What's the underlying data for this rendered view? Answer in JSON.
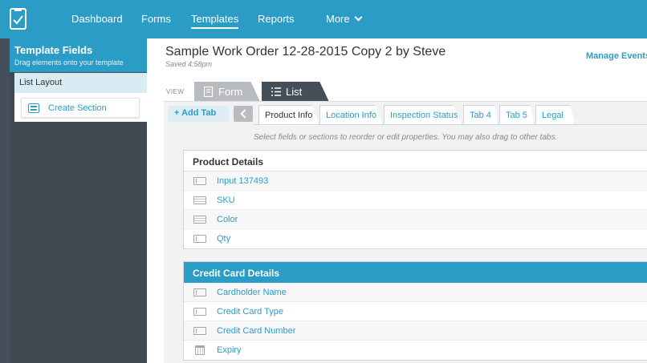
{
  "nav": {
    "items": [
      {
        "label": "Dashboard",
        "active": false
      },
      {
        "label": "Forms",
        "active": false
      },
      {
        "label": "Templates",
        "active": true
      },
      {
        "label": "Reports",
        "active": false
      }
    ],
    "more_label": "More",
    "accent_color": "#2b9cc6"
  },
  "sidebar": {
    "title": "Template Fields",
    "subtitle": "Drag elements onto your template",
    "layout_label": "List Layout",
    "create_section_label": "Create Section"
  },
  "header": {
    "title": "Sample Work Order 12-28-2015 Copy 2 by Steve",
    "saved": "Saved 4:58pm",
    "manage_events": "Manage Events"
  },
  "view": {
    "label": "VIEW",
    "form_label": "Form",
    "list_label": "List",
    "selected": "List"
  },
  "tabs": {
    "add_label": "Add Tab",
    "items": [
      {
        "label": "Product Info",
        "active": true
      },
      {
        "label": "Location Info",
        "active": false
      },
      {
        "label": "Inspection Status",
        "active": false
      },
      {
        "label": "Tab 4",
        "active": false
      },
      {
        "label": "Tab 5",
        "active": false
      },
      {
        "label": "Legal",
        "active": false
      }
    ]
  },
  "hint": "Select fields or sections to reorder or edit properties. You may also drag to other tabs.",
  "sections": [
    {
      "title": "Product Details",
      "selected": false,
      "fields": [
        {
          "label": "Input 137493",
          "icon": "text-field-icon"
        },
        {
          "label": "SKU",
          "icon": "table-field-icon"
        },
        {
          "label": "Color",
          "icon": "table-field-icon"
        },
        {
          "label": "Qty",
          "icon": "text-field-icon"
        }
      ]
    },
    {
      "title": "Credit Card Details",
      "selected": true,
      "fields": [
        {
          "label": "Cardholder Name",
          "icon": "text-field-icon"
        },
        {
          "label": "Credit Card Type",
          "icon": "text-field-icon"
        },
        {
          "label": "Credit Card Number",
          "icon": "text-field-icon"
        },
        {
          "label": "Expiry",
          "icon": "calendar-field-icon"
        }
      ]
    }
  ]
}
